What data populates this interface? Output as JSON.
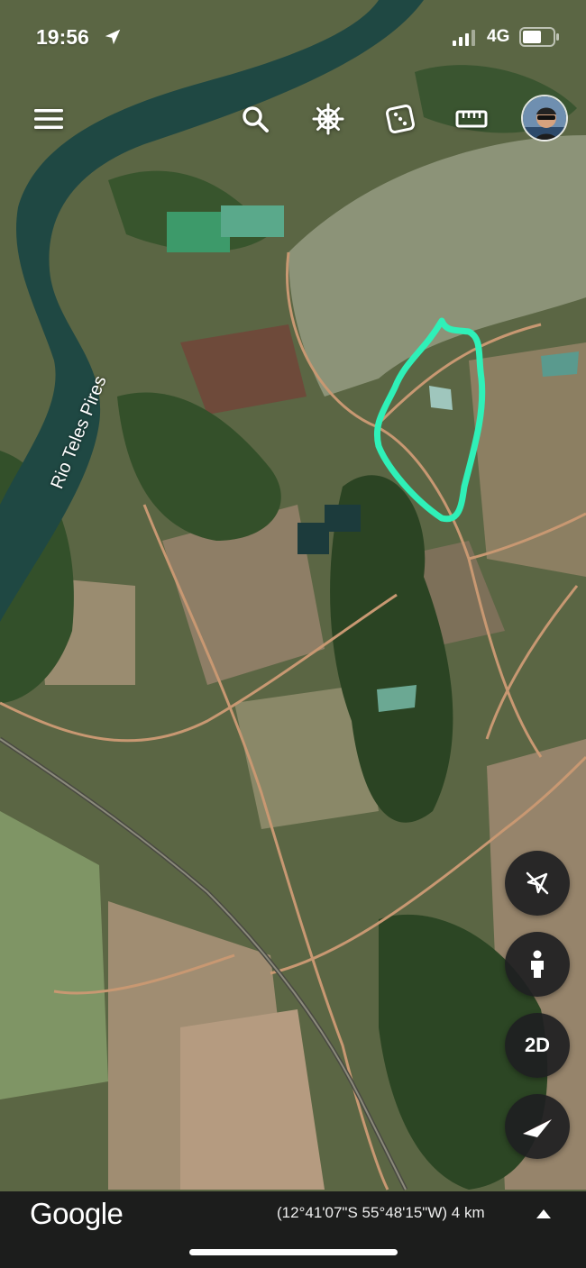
{
  "status_bar": {
    "time": "19:56",
    "network": "4G",
    "icons": [
      "location-arrow-icon",
      "signal-bars-icon",
      "battery-icon"
    ]
  },
  "toolbar": {
    "icons": [
      "menu-icon",
      "search-icon",
      "voyager-wheel-icon",
      "dice-icon",
      "ruler-icon"
    ],
    "avatar": "profile-avatar"
  },
  "map": {
    "river_label": "Rio Teles Pires",
    "colors": {
      "terrain": "#5d6a45",
      "field": "#9a9a7a",
      "forest": "#2f4a26",
      "river": "#1f4a44",
      "road": "#c9946a",
      "highlight_outline": "#2ff0b8"
    }
  },
  "controls": {
    "buttons": [
      {
        "name": "compass-off-icon"
      },
      {
        "name": "pegman-icon"
      },
      {
        "name": "view-2d",
        "label": "2D"
      },
      {
        "name": "compass-needle-icon"
      }
    ]
  },
  "bottom_bar": {
    "brand": "Google",
    "coordinates": "(12°41'07\"S 55°48'15\"W) 4 km",
    "expand_icon": "caret-up-icon"
  }
}
